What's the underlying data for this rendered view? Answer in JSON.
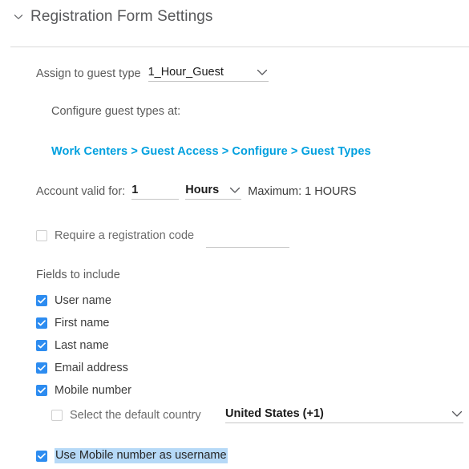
{
  "section": {
    "title": "Registration Form Settings",
    "toggle_icon": "chevron-down-icon",
    "expanded": true
  },
  "guest_type": {
    "label": "Assign to guest type",
    "value": "1_Hour_Guest",
    "caret_icon": "chevron-down-icon",
    "options": [
      "1_Hour_Guest"
    ]
  },
  "configure_hint": {
    "text": "Configure guest types at:",
    "breadcrumb_link": "Work Centers > Guest Access > Configure > Guest Types"
  },
  "account_valid": {
    "label": "Account valid for:",
    "duration_value": "1",
    "duration_placeholder": "",
    "unit_value": "Hours",
    "unit_caret_icon": "chevron-down-icon",
    "unit_options": [
      "Hours"
    ],
    "maximum_text": "Maximum: 1 HOURS"
  },
  "registration_code": {
    "label": "Require a registration code",
    "checked": false,
    "code_value": "",
    "code_placeholder": ""
  },
  "fields_to_include": {
    "group_label": "Fields to include",
    "items": [
      {
        "label": "User name",
        "checked": true
      },
      {
        "label": "First name",
        "checked": true
      },
      {
        "label": "Last name",
        "checked": true
      },
      {
        "label": "Email address",
        "checked": true
      },
      {
        "label": "Mobile number",
        "checked": true
      }
    ]
  },
  "default_country": {
    "label": "Select the default country",
    "checked": false,
    "value": "United States (+1)",
    "caret_icon": "chevron-down-icon",
    "options": [
      "United States (+1)"
    ]
  },
  "mobile_as_username": {
    "label": "Use Mobile number as username",
    "checked": true,
    "highlighted": true
  },
  "colors": {
    "accent_link": "#00a0df",
    "checkbox_blue": "#2d8cf0",
    "selection_highlight": "#b6d9f7",
    "divider": "#d9d9d9",
    "underline": "#c6c6c6",
    "label_text": "#5a5a5a",
    "value_text": "#1b1b1b"
  }
}
